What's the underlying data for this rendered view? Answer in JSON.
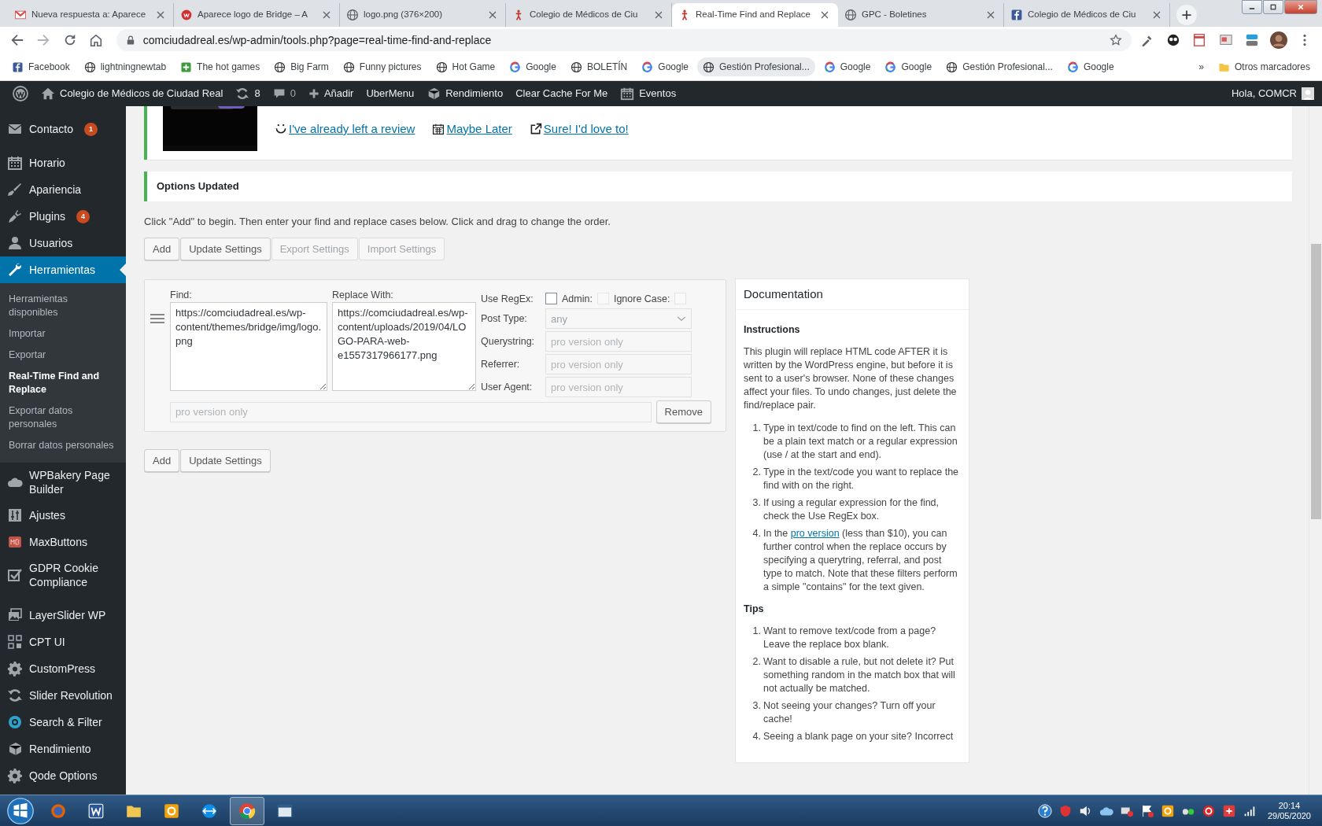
{
  "browser": {
    "tabs": [
      {
        "title": "Nueva respuesta a: Aparece",
        "selected": false
      },
      {
        "title": "Aparece logo de Bridge – A",
        "selected": false
      },
      {
        "title": "logo.png (376×200)",
        "selected": false
      },
      {
        "title": "Colegio de Médicos de Ciu",
        "selected": false
      },
      {
        "title": "Real-Time Find and Replace",
        "selected": true
      },
      {
        "title": "GPC - Boletines",
        "selected": false
      },
      {
        "title": "Colegio de Médicos de Ciu",
        "selected": false
      }
    ],
    "address": "comciudadreal.es/wp-admin/tools.php?page=real-time-find-and-replace",
    "bookmarks": [
      {
        "label": "Facebook",
        "highlighted": false
      },
      {
        "label": "lightningnewtab",
        "highlighted": false
      },
      {
        "label": "The hot games",
        "highlighted": false
      },
      {
        "label": "Big Farm",
        "highlighted": false
      },
      {
        "label": "Funny pictures",
        "highlighted": false
      },
      {
        "label": "Hot Game",
        "highlighted": false
      },
      {
        "label": "Google",
        "highlighted": false
      },
      {
        "label": "BOLETÍN",
        "highlighted": false
      },
      {
        "label": "Google",
        "highlighted": false
      },
      {
        "label": "Gestión Profesional...",
        "highlighted": true
      },
      {
        "label": "Google",
        "highlighted": false
      },
      {
        "label": "Google",
        "highlighted": false
      },
      {
        "label": "Gestión Profesional...",
        "highlighted": false
      },
      {
        "label": "Google",
        "highlighted": false
      }
    ],
    "more_bookmarks": "»",
    "other_bookmarks": "Otros marcadores"
  },
  "admin_bar": {
    "site": "Colegio de Médicos de Ciudad Real",
    "updates": "8",
    "comments": "0",
    "add": "Añadir",
    "items": [
      "UberMenu",
      "Rendimiento",
      "Clear Cache For Me",
      "Eventos"
    ],
    "greeting": "Hola, COMCR"
  },
  "sidebar": {
    "items": [
      {
        "label": "Contacto",
        "badge": "1",
        "selected": false
      },
      {
        "label": "Horario",
        "selected": false
      },
      {
        "label": "Apariencia",
        "selected": false
      },
      {
        "label": "Plugins",
        "badge": "4",
        "selected": false
      },
      {
        "label": "Usuarios",
        "selected": false
      },
      {
        "label": "Herramientas",
        "selected": true,
        "children": [
          {
            "label": "Herramientas disponibles",
            "selected": false
          },
          {
            "label": "Importar",
            "selected": false
          },
          {
            "label": "Exportar",
            "selected": false
          },
          {
            "label": "Real-Time Find and Replace",
            "selected": true
          },
          {
            "label": "Exportar datos personales",
            "selected": false
          },
          {
            "label": "Borrar datos personales",
            "selected": false
          }
        ]
      },
      {
        "label": "WPBakery Page Builder",
        "selected": false
      },
      {
        "label": "Ajustes",
        "selected": false
      },
      {
        "label": "MaxButtons",
        "selected": false
      },
      {
        "label": "GDPR Cookie Compliance",
        "selected": false
      },
      {
        "label": "LayerSlider WP",
        "selected": false
      },
      {
        "label": "CPT UI",
        "selected": false
      },
      {
        "label": "CustomPress",
        "selected": false
      },
      {
        "label": "Slider Revolution",
        "selected": false
      },
      {
        "label": "Search & Filter",
        "selected": false
      },
      {
        "label": "Rendimiento",
        "selected": false
      },
      {
        "label": "Qode Options",
        "selected": false
      }
    ]
  },
  "review_notice": {
    "links": [
      "I've already left a review",
      "Maybe Later",
      "Sure! I'd love to!"
    ]
  },
  "updated_notice": "Options Updated",
  "intro": "Click \"Add\" to begin. Then enter your find and replace cases below. Click and drag to change the order.",
  "top_buttons": [
    {
      "label": "Add",
      "disabled": false
    },
    {
      "label": "Update Settings",
      "disabled": false
    },
    {
      "label": "Export Settings",
      "disabled": true
    },
    {
      "label": "Import Settings",
      "disabled": true
    }
  ],
  "rule": {
    "find_label": "Find:",
    "find": "https://comciudadreal.es/wp-content/themes/bridge/img/logo.png",
    "replace_label": "Replace With:",
    "replace": "https://comciudadreal.es/wp-content/uploads/2019/04/LOGO-PARA-web-e1557317966177.png",
    "flags": [
      {
        "label": "Use RegEx:",
        "checked": false,
        "disabled": false
      },
      {
        "label": "Admin:",
        "checked": false,
        "disabled": true
      },
      {
        "label": "Ignore Case:",
        "checked": false,
        "disabled": true
      }
    ],
    "filters": [
      {
        "label": "Post Type:",
        "kind": "select",
        "value": "any",
        "disabled": true
      },
      {
        "label": "Querystring:",
        "kind": "text",
        "placeholder": "pro version only",
        "disabled": true
      },
      {
        "label": "Referrer:",
        "kind": "text",
        "placeholder": "pro version only",
        "disabled": true
      },
      {
        "label": "User Agent:",
        "kind": "text",
        "placeholder": "pro version only",
        "disabled": true
      }
    ],
    "extra": {
      "placeholder": "pro version only",
      "disabled": true
    },
    "remove": "Remove"
  },
  "bottom_buttons": [
    {
      "label": "Add",
      "disabled": false
    },
    {
      "label": "Update Settings",
      "disabled": false
    }
  ],
  "documentation": {
    "title": "Documentation",
    "sections": [
      {
        "heading": "Instructions",
        "paragraph": "This plugin will replace HTML code AFTER it is written by the WordPress engine, but before it is sent to a user's browser. None of these changes affect your files. To undo changes, just delete the find/replace pair.",
        "steps": [
          {
            "marker": "1.",
            "text": "Type in text/code to find on the left. This can be a plain text match or a regular expression (use / at the start and end)."
          },
          {
            "marker": "2.",
            "text": "Type in the text/code you want to replace the find with on the right."
          },
          {
            "marker": "3.",
            "text": "If using a regular expression for the find, check the Use RegEx box."
          },
          {
            "marker": "4.",
            "text": "In the ",
            "link": "pro version",
            "text_after": " (less than $10), you can further control when the replace occurs by specifying a querytring, referral, and post type to match. Note that these filters perform a simple \"contains\" for the text given."
          }
        ]
      },
      {
        "heading": "Tips",
        "steps": [
          {
            "marker": "1.",
            "text": "Want to remove text/code from a page? Leave the replace box blank."
          },
          {
            "marker": "2.",
            "text": "Want to disable a rule, but not delete it? Put something random in the match box that will not actually be matched."
          },
          {
            "marker": "3.",
            "text": "Not seeing your changes? Turn off your cache!"
          },
          {
            "marker": "4.",
            "text": "Seeing a blank page on your site? Incorrect"
          }
        ]
      }
    ]
  },
  "taskbar": {
    "time": "20:14",
    "date": "29/05/2020"
  }
}
